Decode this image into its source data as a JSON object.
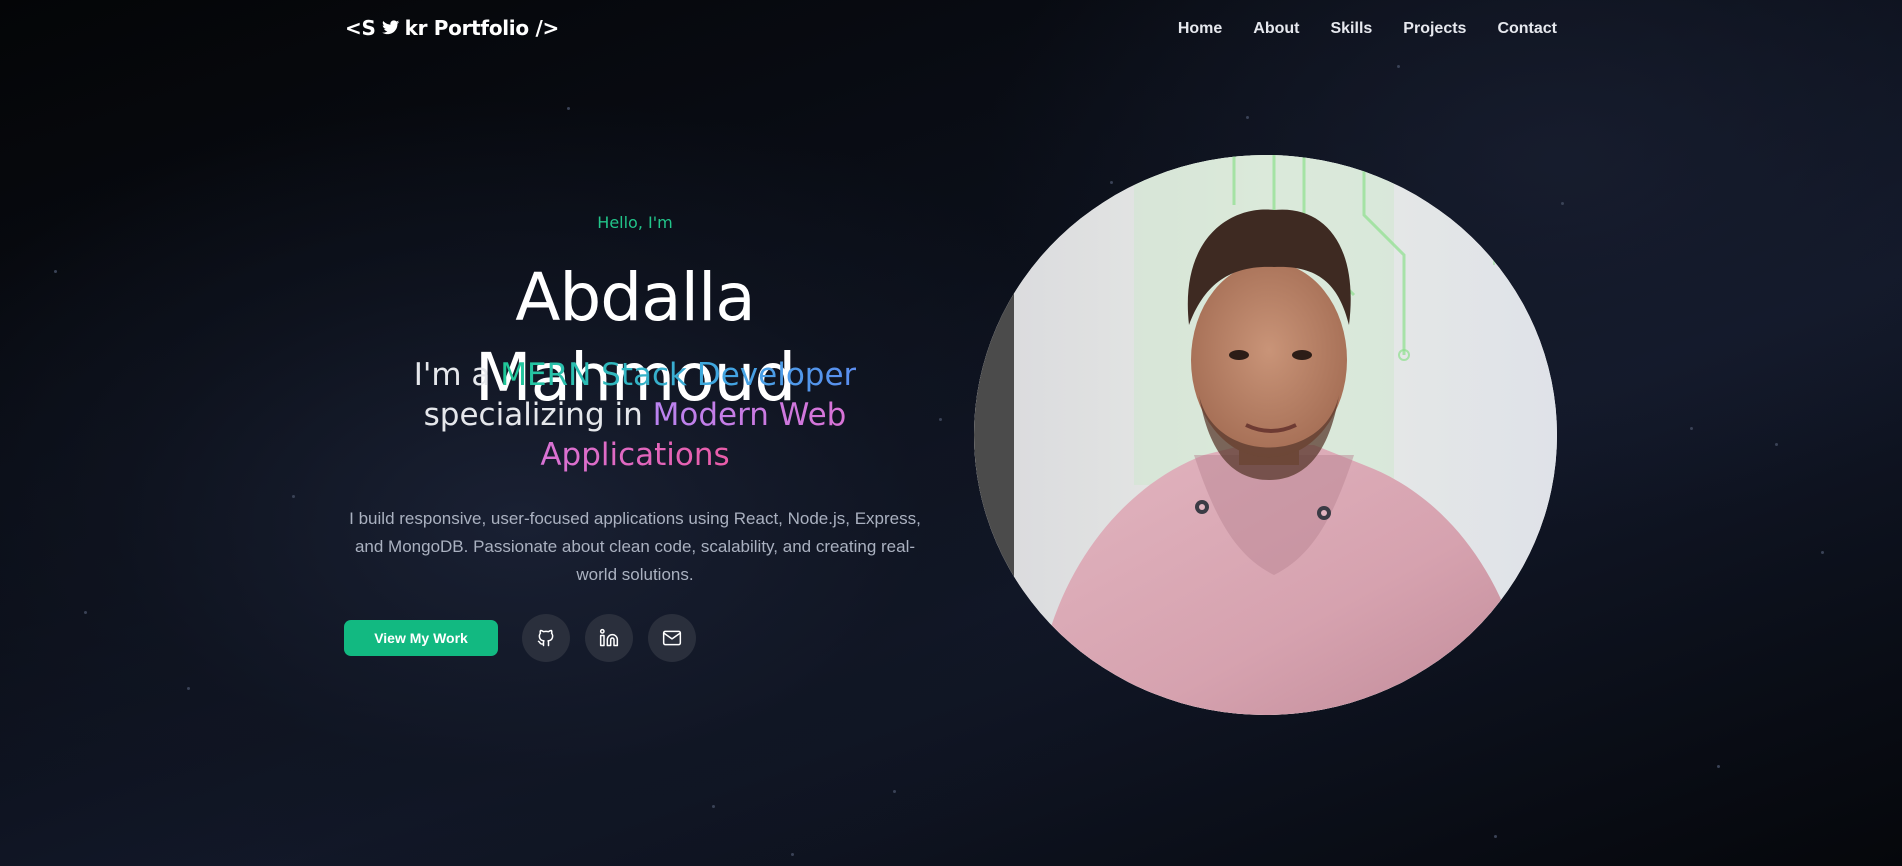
{
  "nav": {
    "logo_prefix": "<S",
    "logo_suffix": "kr Portfolio />",
    "logo_icon": "bird-icon",
    "links": [
      "Home",
      "About",
      "Skills",
      "Projects",
      "Contact"
    ]
  },
  "hero": {
    "greeting": "Hello, I'm",
    "name": "Abdalla Mahmoud",
    "role_prefix": "I'm a",
    "role_highlight_1": "MERN Stack Developer",
    "role_middle": "specializing in",
    "role_highlight_2": "Modern Web Applications",
    "bio": "I build responsive, user-focused applications using React, Node.js, Express, and MongoDB. Passionate about clean code, scalability, and creating real-world solutions.",
    "cta_label": "View My Work",
    "social_icons": [
      "github-icon",
      "linkedin-icon",
      "mail-icon"
    ]
  },
  "colors": {
    "accent": "#12b981",
    "greeting": "#22c58a",
    "social_bg": "#2a2f3c"
  }
}
